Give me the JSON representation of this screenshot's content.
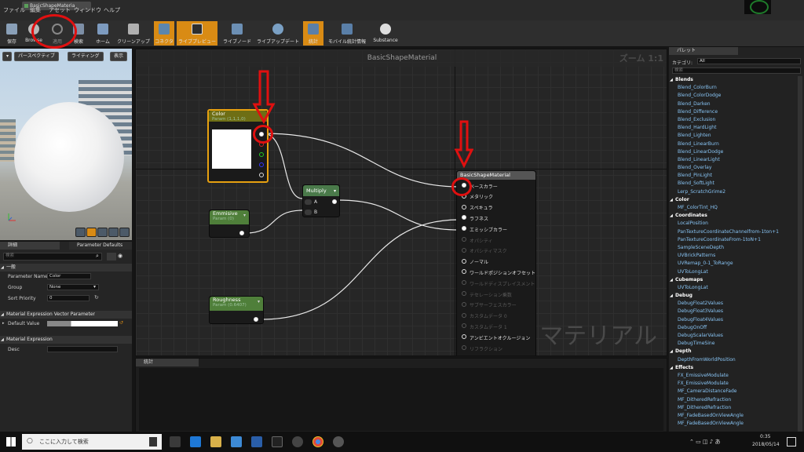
{
  "app": {
    "tab_title": "BasicShapeMateria"
  },
  "menu": [
    "ファイル",
    "編集",
    "アセット",
    "ウィンドウ",
    "ヘルプ"
  ],
  "toolbar": [
    {
      "label": "保存",
      "active": false
    },
    {
      "label": "Browse",
      "active": false
    },
    {
      "label": "適用",
      "active": false
    },
    {
      "label": "検索",
      "active": false
    },
    {
      "label": "ホーム",
      "active": false
    },
    {
      "label": "クリーンアップ",
      "active": false
    },
    {
      "label": "コネクタ",
      "active": true
    },
    {
      "label": "ライブプレビュー",
      "active": true
    },
    {
      "label": "ライブノード",
      "active": false
    },
    {
      "label": "ライブアップデート",
      "active": false
    },
    {
      "label": "統計",
      "active": true
    },
    {
      "label": "モバイル統計情報",
      "active": false
    },
    {
      "label": "Substance",
      "active": false
    }
  ],
  "viewport": {
    "perspective_btn": "パースペクティブ",
    "lighting_btn": "ライティング",
    "show_btn": "表示"
  },
  "details": {
    "tab_details": "詳細",
    "tab_param_defaults": "Parameter Defaults",
    "search_placeholder": "検索",
    "section_general": "一般",
    "param_name_label": "Parameter Name",
    "param_name_value": "Color",
    "group_label": "Group",
    "group_value": "None",
    "sort_priority_label": "Sort Priority",
    "sort_priority_value": "0",
    "section_vector": "Material Expression Vector Parameter",
    "default_value_label": "Default Value",
    "section_expression": "Material Expression",
    "desc_label": "Desc"
  },
  "graph": {
    "title": "BasicShapeMaterial",
    "zoom": "ズーム 1:1",
    "watermark": "マテリアル",
    "nodes": {
      "color": {
        "title": "Color",
        "sub": "Param (1,1,1,0)"
      },
      "multiply": {
        "title": "Multiply",
        "pin_a": "A",
        "pin_b": "B"
      },
      "emissive": {
        "title": "Emmisive",
        "sub": "Param (0)"
      },
      "roughness": {
        "title": "Roughness",
        "sub": "Param (0.6407)"
      },
      "material": {
        "title": "BasicShapeMaterial",
        "pins": [
          {
            "label": "ベースカラー",
            "enabled": true,
            "connected": true
          },
          {
            "label": "メタリック",
            "enabled": true,
            "connected": false
          },
          {
            "label": "スペキュラ",
            "enabled": true,
            "connected": false
          },
          {
            "label": "ラフネス",
            "enabled": true,
            "connected": true
          },
          {
            "label": "エミッシブカラー",
            "enabled": true,
            "connected": true
          },
          {
            "label": "オパシティ",
            "enabled": false,
            "connected": false
          },
          {
            "label": "オパシティマスク",
            "enabled": false,
            "connected": false
          },
          {
            "label": "ノーマル",
            "enabled": true,
            "connected": false
          },
          {
            "label": "ワールドポジションオフセット",
            "enabled": true,
            "connected": false
          },
          {
            "label": "ワールドディスプレイスメント",
            "enabled": false,
            "connected": false
          },
          {
            "label": "テセレーション乗数",
            "enabled": false,
            "connected": false
          },
          {
            "label": "サブサーフェスカラー",
            "enabled": false,
            "connected": false
          },
          {
            "label": "カスタムデータ 0",
            "enabled": false,
            "connected": false
          },
          {
            "label": "カスタムデータ 1",
            "enabled": false,
            "connected": false
          },
          {
            "label": "アンビエントオクルージョン",
            "enabled": true,
            "connected": false
          },
          {
            "label": "リフラクション",
            "enabled": false,
            "connected": false
          }
        ]
      }
    }
  },
  "stats": {
    "tab": "統計"
  },
  "palette": {
    "tab": "パレット",
    "category_label": "カテゴリ:",
    "category_value": "All",
    "search_placeholder": "検索",
    "groups": [
      {
        "name": "Blends",
        "items": [
          "Blend_ColorBurn",
          "Blend_ColorDodge",
          "Blend_Darken",
          "Blend_Difference",
          "Blend_Exclusion",
          "Blend_HardLight",
          "Blend_Lighten",
          "Blend_LinearBurn",
          "Blend_LinearDodge",
          "Blend_LinearLight",
          "Blend_Overlay",
          "Blend_PinLight",
          "Blend_SoftLight",
          "Lerp_ScratchGrime2"
        ]
      },
      {
        "name": "Color",
        "items": [
          "MF_ColorTint_HQ"
        ]
      },
      {
        "name": "Coordinates",
        "items": [
          "LocalPosition",
          "PanTextureCoordinateChannelfrom-1ton+1",
          "PanTextureCoordinateFrom-1toN+1",
          "SampleSceneDepth",
          "UVBrickPatterns",
          "UVRemap_0-1_ToRange",
          "UVToLongLat"
        ]
      },
      {
        "name": "Cubemaps",
        "items": [
          "UVToLongLat"
        ]
      },
      {
        "name": "Debug",
        "items": [
          "DebugFloat2Values",
          "DebugFloat3Values",
          "DebugFloat4Values",
          "DebugOnOff",
          "DebugScalarValues",
          "DebugTimeSine"
        ]
      },
      {
        "name": "Depth",
        "items": [
          "DepthFromWorldPosition"
        ]
      },
      {
        "name": "Effects",
        "items": [
          "FX_EmissiveModulate",
          "FX_EmissiveModulate",
          "MF_CameraDistanceFade",
          "MF_DitheredRefraction",
          "MF_DitheredRefraction",
          "MF_FadeBasedOnViewAngle",
          "MF_FadeBasedOnViewAngle"
        ]
      }
    ]
  },
  "taskbar": {
    "search_placeholder": "ここに入力して検索",
    "time": "0:35",
    "date": "2018/05/14"
  }
}
